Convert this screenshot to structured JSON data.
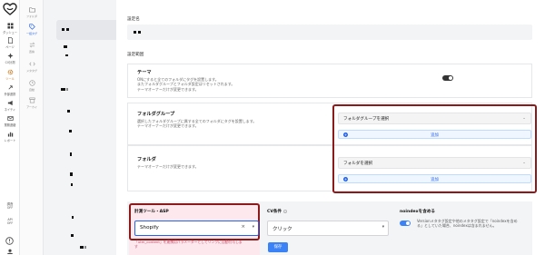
{
  "rail": {
    "items": [
      {
        "label": "ダッシュー",
        "icon": "grid-icon"
      },
      {
        "label": "ページ",
        "icon": "page-icon"
      },
      {
        "label": "CV計測",
        "icon": "spark-icon"
      },
      {
        "label": "ツール",
        "icon": "gear-icon",
        "active": true
      },
      {
        "label": "外部連携",
        "icon": "link-icon"
      },
      {
        "label": "ネイティ",
        "icon": "megaphone-icon"
      },
      {
        "label": "業務連絡",
        "icon": "mail-icon"
      },
      {
        "label": "レポート",
        "icon": "chart-icon"
      }
    ],
    "bottom": [
      {
        "label": "調査",
        "value": "OFF"
      },
      {
        "label": "API",
        "value": "OFF"
      }
    ]
  },
  "subnav": {
    "items": [
      {
        "label": "フォルダ",
        "icon": "folder-icon"
      },
      {
        "label": "一括タグ",
        "icon": "tag-icon",
        "active": true
      },
      {
        "label": "置換",
        "icon": "swap-icon"
      },
      {
        "label": "メタタグ",
        "icon": "code-icon"
      },
      {
        "label": "自動",
        "icon": "clock-icon"
      },
      {
        "label": "アーカイ",
        "icon": "archive-icon"
      }
    ]
  },
  "form": {
    "name_label": "設定名",
    "scope_label": "設定範囲",
    "theme": {
      "title": "テーマ",
      "desc": "ONにすると全てのフォルダにタグを設置します。\nまたフォルダグループとフォルダ設定はリセットされます。\nテーマオーナーだけが変更できます。"
    },
    "folder_group": {
      "title": "フォルダグループ",
      "desc": "選択したフォルダグループに属する全てのフォルダにタグを設置します。\nテーマオーナーだけが変更できます。",
      "select_placeholder": "フォルダグループを選択",
      "add_label": "追加"
    },
    "folder": {
      "title": "フォルダ",
      "desc": "テーマオーナーだけが変更できます。",
      "select_placeholder": "フォルダを選択",
      "add_label": "追加"
    },
    "tool": {
      "label": "計測ツール・ASP",
      "value": "Shopify",
      "note": "「utm_content」を連携用パラメーターとしてリンクに自動付与しま\nす"
    },
    "cv": {
      "label": "CV条件",
      "value": "クリック",
      "save_label": "保存"
    },
    "noindex": {
      "label": "noindexを含める",
      "desc": "Versionメタタグ設定や他のメタタグ設定で「noindexを含め\nる」としていた場合、noindexは含まれません。"
    }
  },
  "colors": {
    "accent_blue": "#3b82f6",
    "highlight_red": "#8b1a1a",
    "active_orange": "#c2731a"
  }
}
